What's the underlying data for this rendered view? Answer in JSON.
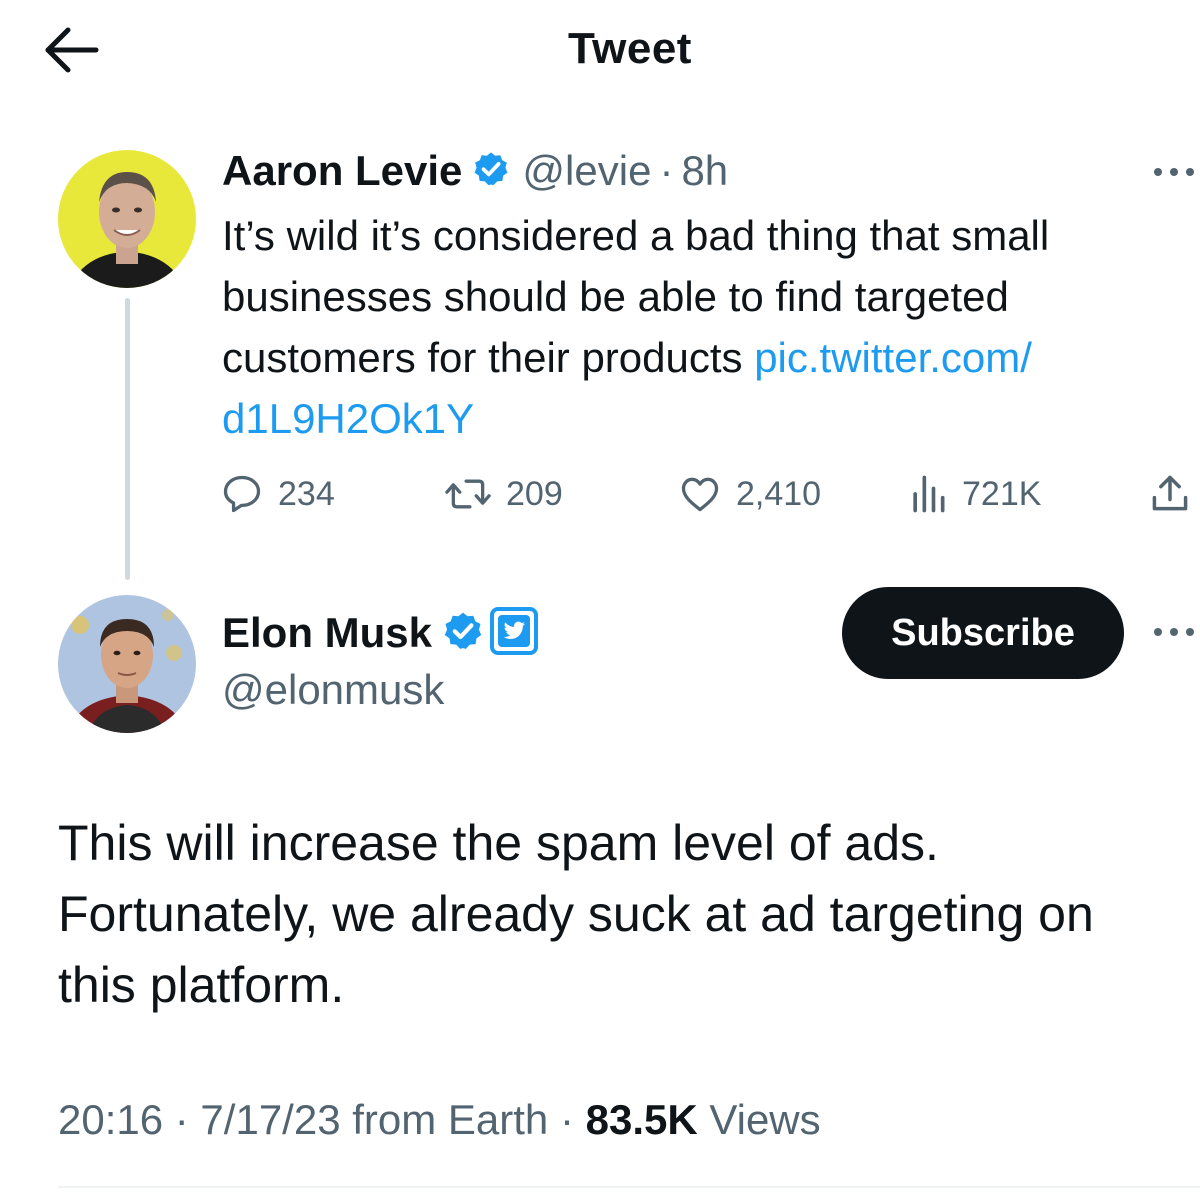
{
  "header": {
    "title": "Tweet"
  },
  "quoted_tweet": {
    "display_name": "Aaron Levie",
    "handle": "@levie",
    "separator": "·",
    "time": "8h",
    "text": "It’s wild it’s considered a bad thing that small businesses should be able to find targeted customers for their products ",
    "link": "pic.twitter.com/​d1L9H2Ok1Y",
    "replies": "234",
    "retweets": "209",
    "likes": "2,410",
    "views": "721K"
  },
  "main_tweet": {
    "display_name": "Elon Musk",
    "handle": "@elonmusk",
    "subscribe_label": "Subscribe",
    "text": "This will increase the spam level of ads. Fortunately, we already suck at ad targeting on this platform.",
    "meta_prefix": "20:16 · 7/17/23 from Earth · ",
    "views_count": "83.5K",
    "views_label": " Views"
  },
  "colors": {
    "accent": "#1d9bf0",
    "text_primary": "#0f1419",
    "text_secondary": "#536471",
    "thread_line": "#cfd9de",
    "button_dark": "#0f1419"
  },
  "icons": [
    "arrow-left-icon",
    "verified-badge-icon",
    "twitter-bird-badge-icon",
    "more-dots-icon",
    "reply-icon",
    "retweet-icon",
    "like-icon",
    "views-icon",
    "share-icon"
  ]
}
